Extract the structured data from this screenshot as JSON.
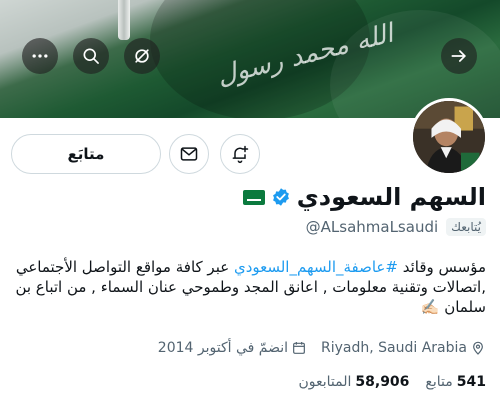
{
  "header": {
    "actions": [
      {
        "name": "more",
        "icon": "more-icon"
      },
      {
        "name": "search",
        "icon": "search-icon"
      },
      {
        "name": "mute",
        "icon": "mute-icon"
      },
      {
        "name": "back",
        "icon": "arrow-right-icon"
      }
    ],
    "banner_script": "الله محمد رسول"
  },
  "profile": {
    "display_name": "السهم السعودي",
    "flag": "🇸🇦",
    "verified": true,
    "handle": "@ALsahmaLsaudi",
    "follows_you_label": "يُتابعك",
    "bio": {
      "before_tag": "مؤسس وقائد ",
      "tag": "#عاصفة_السهم_السعودي",
      "after_tag": " عبر كافة مواقع التواصل الأجتماعي ,اتصالات وتقنية معلومات , اعانق المجد وطموحي عنان السماء , من اتباع بن سلمان ✍🏻"
    },
    "location": "Riyadh, Saudi Arabia",
    "joined": "انضمّ في أكتوبر 2014",
    "following_count": "541",
    "following_label": "متابع",
    "followers_count": "58,906",
    "followers_label": "المتابعون"
  },
  "buttons": {
    "follow_label": "متابَع"
  },
  "colors": {
    "accent": "#1d9bf0",
    "banner_green": "#1e5a33",
    "text": "#0f1419",
    "muted": "#536471"
  }
}
